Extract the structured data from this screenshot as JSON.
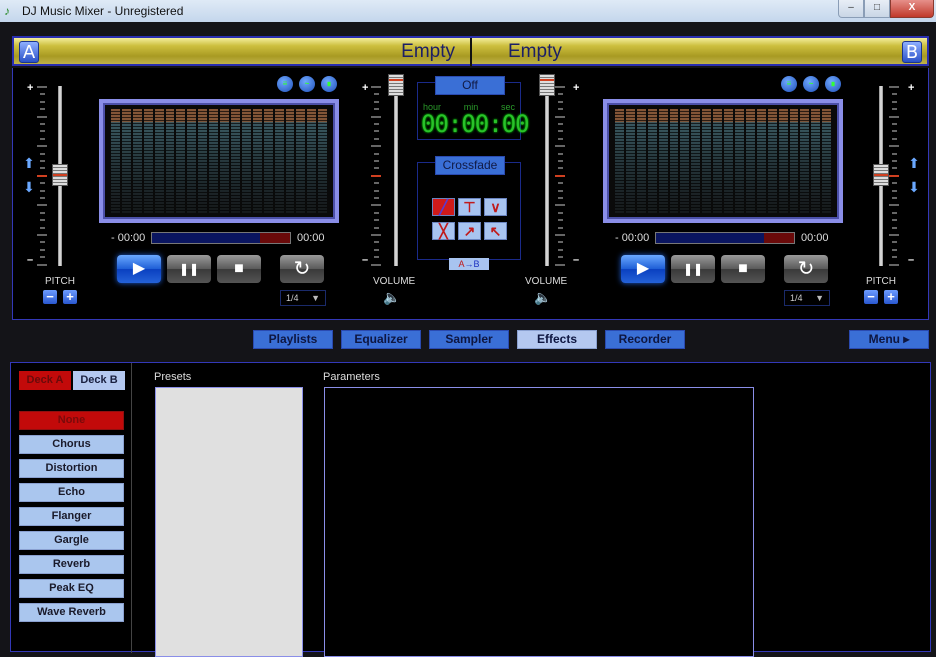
{
  "window": {
    "title": "DJ Music Mixer - Unregistered",
    "controls": {
      "minimize": "–",
      "maximize": "□",
      "close": "X"
    }
  },
  "deck_bar": {
    "deck_a": {
      "letter": "A",
      "title": "Empty"
    },
    "deck_b": {
      "letter": "B",
      "title": "Empty"
    }
  },
  "decks": {
    "a": {
      "pitch_label": "PITCH",
      "pitch_minus": "−",
      "pitch_plus": "+",
      "scale_plus": "+",
      "scale_minus": "–",
      "pitch_value_fraction": 0.5,
      "viz_icons": [
        "spectrum-icon",
        "waveform-icon",
        "bars-icon"
      ],
      "time_remaining": "- 00:00",
      "time_elapsed": "00:00",
      "progress_fraction": 0.0,
      "loop_value": "1/4",
      "volume_label": "VOLUME",
      "volume_fraction": 1.0
    },
    "b": {
      "pitch_label": "PITCH",
      "pitch_minus": "−",
      "pitch_plus": "+",
      "scale_plus": "+",
      "scale_minus": "–",
      "pitch_value_fraction": 0.5,
      "viz_icons": [
        "spectrum-icon",
        "waveform-icon",
        "bars-icon"
      ],
      "time_remaining": "- 00:00",
      "time_elapsed": "00:00",
      "progress_fraction": 0.0,
      "loop_value": "1/4",
      "volume_label": "VOLUME",
      "volume_fraction": 1.0
    }
  },
  "center": {
    "timer_button": "Off",
    "timer_labels": {
      "hour": "hour",
      "min": "min",
      "sec": "sec"
    },
    "timer_digits": "00:00:00",
    "crossfade_button": "Crossfade",
    "crossfade_modes": [
      "linear-x",
      "cut-t",
      "v-dip",
      "cross-x",
      "fade-up",
      "fade-down"
    ],
    "crossfade_selected": 0,
    "ab_label_a": "A",
    "ab_label_arrow": "→",
    "ab_label_b": "B"
  },
  "nav": {
    "tabs": [
      {
        "label": "Playlists",
        "active": false
      },
      {
        "label": "Equalizer",
        "active": false
      },
      {
        "label": "Sampler",
        "active": false
      },
      {
        "label": "Effects",
        "active": true
      },
      {
        "label": "Recorder",
        "active": false
      }
    ],
    "menu_label": "Menu ▸"
  },
  "effects": {
    "deck_tabs": [
      {
        "label": "Deck A",
        "active": true
      },
      {
        "label": "Deck B",
        "active": false
      }
    ],
    "items": [
      {
        "label": "None",
        "active": true
      },
      {
        "label": "Chorus",
        "active": false
      },
      {
        "label": "Distortion",
        "active": false
      },
      {
        "label": "Echo",
        "active": false
      },
      {
        "label": "Flanger",
        "active": false
      },
      {
        "label": "Gargle",
        "active": false
      },
      {
        "label": "Reverb",
        "active": false
      },
      {
        "label": "Peak EQ",
        "active": false
      },
      {
        "label": "Wave Reverb",
        "active": false
      }
    ],
    "presets_label": "Presets",
    "parameters_label": "Parameters"
  },
  "icons": {
    "play": "▶",
    "pause": "❚❚",
    "stop": "■",
    "loop": "↻",
    "up": "⬆",
    "down": "⬇",
    "speaker": "🔈",
    "dropdown": "▼",
    "app": "♪"
  }
}
